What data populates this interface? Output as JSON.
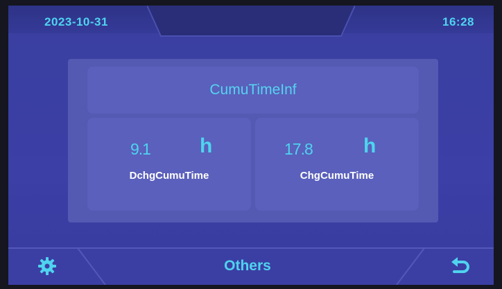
{
  "header": {
    "date": "2023-10-31",
    "time": "16:28"
  },
  "panel": {
    "title": "CumuTimeInf",
    "stats": [
      {
        "value": "9.1",
        "unit": "h",
        "label": "DchgCumuTime"
      },
      {
        "value": "17.8",
        "unit": "h",
        "label": "ChgCumuTime"
      }
    ]
  },
  "footer": {
    "settings_icon": "gear-icon",
    "center_label": "Others",
    "back_icon": "return-arrow-icon"
  },
  "colors": {
    "accent": "#4fd3ef",
    "background": "#3b3fa6",
    "panel": "#5459b2"
  }
}
